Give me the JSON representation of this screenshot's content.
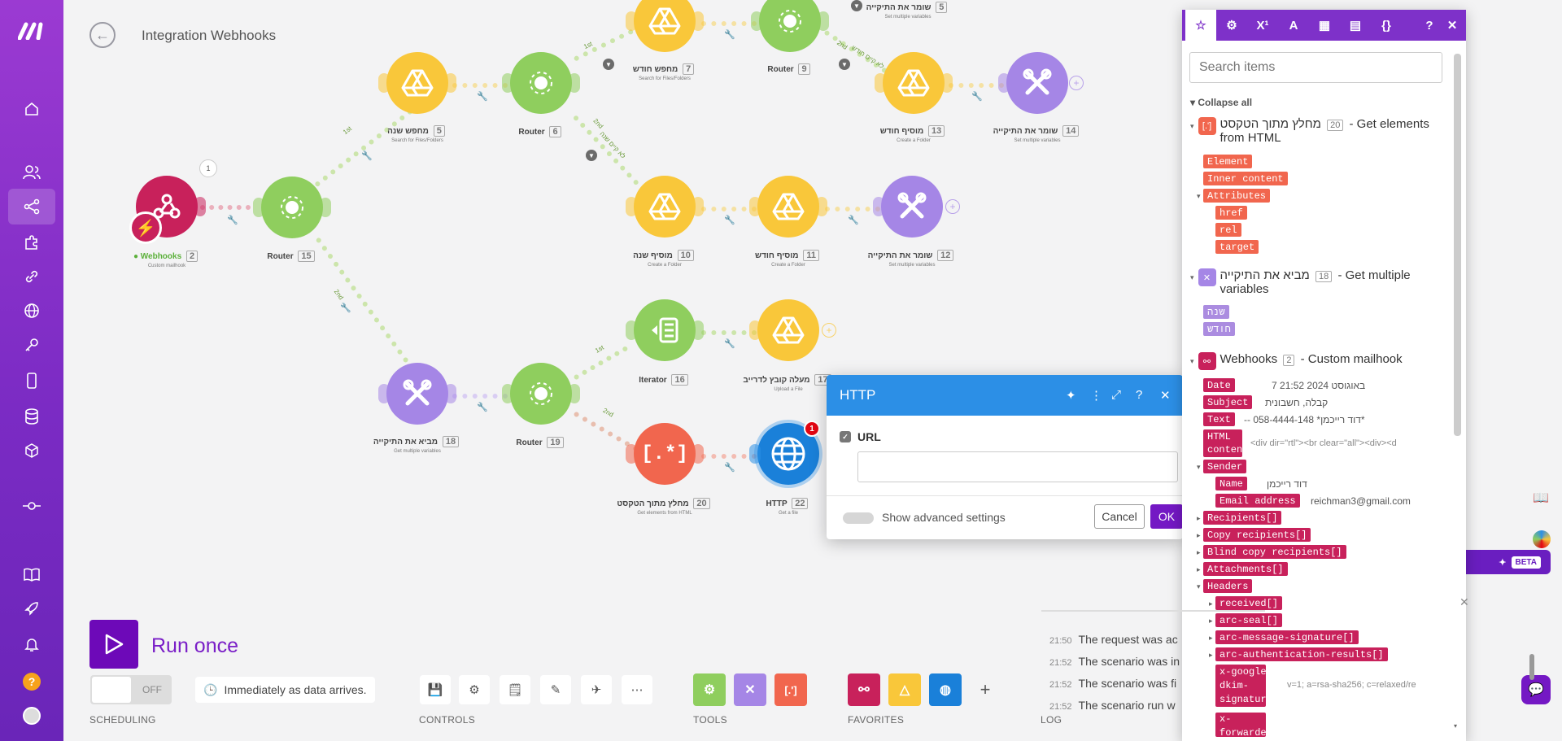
{
  "header": {
    "title": "Integration Webhooks",
    "back_icon": "arrow-left-icon"
  },
  "sidebar": {
    "items": [
      {
        "name": "logo",
        "icon": "make-logo"
      },
      {
        "name": "home",
        "icon": "home-icon"
      },
      {
        "name": "team",
        "icon": "users-icon"
      },
      {
        "name": "scenarios",
        "icon": "share-icon",
        "active": true
      },
      {
        "name": "templates",
        "icon": "puzzle-icon"
      },
      {
        "name": "connections",
        "icon": "link-icon"
      },
      {
        "name": "webhooks",
        "icon": "globe-icon"
      },
      {
        "name": "keys",
        "icon": "key-icon"
      },
      {
        "name": "devices",
        "icon": "device-icon"
      },
      {
        "name": "datastores",
        "icon": "database-icon"
      },
      {
        "name": "datastructures",
        "icon": "cube-icon"
      },
      {
        "name": "flow",
        "icon": "commit-icon"
      },
      {
        "name": "docs",
        "icon": "book-icon"
      },
      {
        "name": "whatsnew",
        "icon": "rocket-icon"
      },
      {
        "name": "notifications",
        "icon": "bell-icon"
      },
      {
        "name": "help",
        "icon": "help-icon"
      },
      {
        "name": "profile",
        "icon": "avatar-icon"
      }
    ]
  },
  "nodes": {
    "webhooks": {
      "label": "Webhooks",
      "num": "2",
      "sub": "Custom mailhook",
      "queue": "1"
    },
    "router1": {
      "label": "Router",
      "num": "15"
    },
    "search_year": {
      "label": "מחפש שנה",
      "num": "5",
      "sub": "Search for Files/Folders"
    },
    "router_top": {
      "label": "Router",
      "num": "6"
    },
    "search_month": {
      "label": "מחפש חודש",
      "num": "7",
      "sub": "Search for Files/Folders"
    },
    "router_9": {
      "label": "Router",
      "num": "9"
    },
    "save_var_top": {
      "label": "שומר את התיקייה",
      "num": "5",
      "sub": "Set multiple variables"
    },
    "add_month_top": {
      "label": "מוסיף חודש",
      "num": "13",
      "sub": "Create a Folder"
    },
    "save_var_right": {
      "label": "שומר את התיקייה",
      "num": "14",
      "sub": "Set multiple variables"
    },
    "add_year": {
      "label": "מוסיף שנה",
      "num": "10",
      "sub": "Create a Folder"
    },
    "add_month_mid": {
      "label": "מוסיף חודש",
      "num": "11",
      "sub": "Create a Folder"
    },
    "save_var_mid": {
      "label": "שומר את התיקייה",
      "num": "12",
      "sub": "Set multiple variables"
    },
    "bring_folder": {
      "label": "מביא את התיקייה",
      "num": "18",
      "sub": "Get multiple variables"
    },
    "router_19": {
      "label": "Router",
      "num": "19"
    },
    "iterator": {
      "label": "Iterator",
      "num": "16"
    },
    "upload": {
      "label": "מעלה קובץ לדרייב",
      "num": "17",
      "sub": "Upload a File"
    },
    "html_extract": {
      "label": "מחלץ מתוך הטקסט",
      "num": "20",
      "sub": "Get elements from HTML"
    },
    "http": {
      "label": "HTTP",
      "num": "22",
      "sub": "Get a file",
      "badge": "1"
    }
  },
  "routes": {
    "first": "1st",
    "second": "2nd",
    "filter_a": "לא קיים שנה",
    "filter_b": "לא קיים חודש"
  },
  "http_dialog": {
    "title": "HTTP",
    "url_label": "URL",
    "url_value": "",
    "advanced_label": "Show advanced settings",
    "cancel": "Cancel",
    "ok": "OK"
  },
  "mapper": {
    "search_placeholder": "Search items",
    "collapse_all": "Collapse all",
    "module1": {
      "name": "מחלץ מתוך הטקסט",
      "num": "20",
      "desc": "- Get elements from HTML",
      "icon_text": "[.']",
      "items": [
        "Element",
        "Inner content",
        "Attributes",
        "href",
        "rel",
        "target"
      ]
    },
    "module2": {
      "name": "מביא את התיקייה",
      "num": "18",
      "desc": "- Get multiple variables",
      "items": [
        "שנה",
        "חודש"
      ]
    },
    "module3": {
      "name": "Webhooks",
      "num": "2",
      "desc": "- Custom mailhook",
      "date": {
        "key": "Date",
        "value": "7 באוגוסט 2024 21:52"
      },
      "subject": {
        "key": "Subject",
        "value": "קבלה, חשבונית"
      },
      "text": {
        "key": "Text",
        "value": "-- דוד רייכמן* 058-4444-148*"
      },
      "html": {
        "key": "HTML content",
        "value": "<div dir=\"rtl\"><br clear=\"all\"><div><d"
      },
      "sender": {
        "key": "Sender"
      },
      "sender_name": {
        "key": "Name",
        "value": "דוד רייכמן"
      },
      "sender_email": {
        "key": "Email address",
        "value": "reichman3@gmail.com"
      },
      "arrays": [
        "Recipients[]",
        "Copy recipients[]",
        "Blind copy recipients[]",
        "Attachments[]"
      ],
      "headers": {
        "key": "Headers"
      },
      "header_items": [
        "received[]",
        "arc-seal[]",
        "arc-message-signature[]",
        "arc-authentication-results[]"
      ],
      "dkim": {
        "key": "x-google-dkim-signature",
        "value": "v=1; a=rsa-sha256; c=relaxed/re"
      },
      "xfwd": {
        "key": "x-forwarded"
      }
    }
  },
  "beta": {
    "label": "BETA"
  },
  "bottom": {
    "run_label": "Run once",
    "scheduling_off": "OFF",
    "scheduling_text": "Immediately as data arrives.",
    "labels": {
      "scheduling": "SCHEDULING",
      "controls": "CONTROLS",
      "tools": "TOOLS",
      "favorites": "FAVORITES",
      "log": "LOG"
    }
  },
  "log": {
    "rows": [
      {
        "time": "21:50",
        "text": "The request was ac"
      },
      {
        "time": "21:52",
        "text": "The scenario was in"
      },
      {
        "time": "21:52",
        "text": "The scenario was fi"
      },
      {
        "time": "21:52",
        "text": "The scenario run w"
      }
    ]
  },
  "colors": {
    "purple": "#7e31c9",
    "green": "#8fce5e",
    "yellow": "#f9c73a",
    "violet": "#a586e6",
    "red": "#f1664e",
    "magenta": "#c8215b",
    "blue": "#2c8fe6"
  }
}
